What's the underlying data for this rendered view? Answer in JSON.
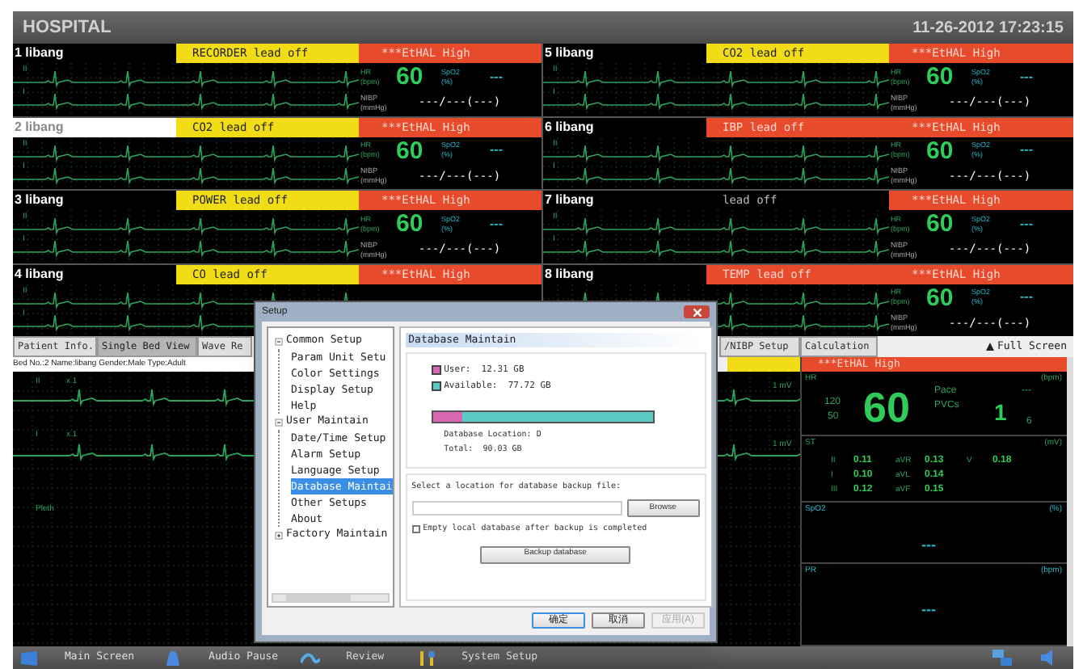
{
  "header": {
    "title": "HOSPITAL",
    "datetime": "11-26-2012 17:23:15"
  },
  "beds": [
    {
      "name": "1 libang",
      "selected": false,
      "alert": {
        "text": "RECORDER lead off",
        "color": "#f2dc16"
      },
      "alarm": "***EtHAL High",
      "leads": [
        "II",
        "I"
      ],
      "params": [
        {
          "kind": "hr",
          "label": "HR",
          "unit": "(bpm)",
          "value": "60"
        },
        {
          "kind": "spo2",
          "label": "SpO2",
          "unit": "(%)",
          "value": "---"
        },
        {
          "kind": "nibp",
          "label": "NIBP",
          "unit": "(mmHg)",
          "value": "---/---(---)"
        }
      ]
    },
    {
      "name": "5 libang",
      "selected": false,
      "alert": {
        "text": "CO2 lead off",
        "color": "#f2dc16"
      },
      "alarm": "***EtHAL High",
      "leads": [
        "II",
        "I"
      ],
      "params": [
        {
          "kind": "hr",
          "label": "HR",
          "unit": "(bpm)",
          "value": "60"
        },
        {
          "kind": "spo2",
          "label": "SpO2",
          "unit": "(%)",
          "value": "---"
        },
        {
          "kind": "nibp",
          "label": "NIBP",
          "unit": "(mmHg)",
          "value": "---/---(---)"
        }
      ]
    },
    {
      "name": "2 libang",
      "selected": true,
      "alert": {
        "text": "CO2 lead off",
        "color": "#f2dc16"
      },
      "alarm": "***EtHAL High",
      "leads": [
        "II",
        "I"
      ],
      "params": [
        {
          "kind": "hr",
          "label": "HR",
          "unit": "(bpm)",
          "value": "60"
        },
        {
          "kind": "spo2",
          "label": "SpO2",
          "unit": "(%)",
          "value": "---"
        },
        {
          "kind": "nibp",
          "label": "NIBP",
          "unit": "(mmHg)",
          "value": "---/---(---)"
        }
      ]
    },
    {
      "name": "6 libang",
      "selected": false,
      "alert": {
        "text": "IBP lead off",
        "color": "#e84a2c"
      },
      "alarm": "***EtHAL High",
      "leads": [
        "II",
        "I"
      ],
      "params": [
        {
          "kind": "hr",
          "label": "HR",
          "unit": "(bpm)",
          "value": "60"
        },
        {
          "kind": "spo2",
          "label": "SpO2",
          "unit": "(%)",
          "value": "---"
        },
        {
          "kind": "nibp",
          "label": "NIBP",
          "unit": "(mmHg)",
          "value": "---/---(---)"
        }
      ]
    },
    {
      "name": "3 libang",
      "selected": false,
      "alert": {
        "text": "POWER lead off",
        "color": "#f2dc16"
      },
      "alarm": "***EtHAL High",
      "leads": [
        "II",
        "I"
      ],
      "params": [
        {
          "kind": "hr",
          "label": "HR",
          "unit": "(bpm)",
          "value": "60"
        },
        {
          "kind": "spo2",
          "label": "SpO2",
          "unit": "(%)",
          "value": "---"
        },
        {
          "kind": "nibp",
          "label": "NIBP",
          "unit": "(mmHg)",
          "value": "---/---(---)"
        }
      ]
    },
    {
      "name": "7 libang",
      "selected": false,
      "alert": {
        "text": "lead off",
        "color": "#000000"
      },
      "alarm": "***EtHAL High",
      "leads": [
        "II",
        "I"
      ],
      "params": [
        {
          "kind": "hr",
          "label": "HR",
          "unit": "(bpm)",
          "value": "60"
        },
        {
          "kind": "spo2",
          "label": "SpO2",
          "unit": "(%)",
          "value": "---"
        },
        {
          "kind": "nibp",
          "label": "NIBP",
          "unit": "(mmHg)",
          "value": "---/---(---)"
        }
      ]
    },
    {
      "name": "4 libang",
      "selected": false,
      "alert": {
        "text": "CO lead off",
        "color": "#f2dc16"
      },
      "alarm": "***EtHAL High",
      "leads": [
        "II",
        "I"
      ]
    },
    {
      "name": "8 libang",
      "selected": false,
      "alert": {
        "text": "TEMP lead off",
        "color": "#e84a2c"
      },
      "alarm": "***EtHAL High",
      "params": [
        {
          "kind": "hr",
          "label": "HR",
          "unit": "(bpm)",
          "value": "60"
        },
        {
          "kind": "spo2",
          "label": "SpO2",
          "unit": "(%)",
          "value": "---"
        },
        {
          "kind": "nibp",
          "label": "NIBP",
          "unit": "(mmHg)",
          "value": "---/---(---)"
        }
      ]
    }
  ],
  "tabs": [
    {
      "label": "Patient Info.",
      "selected": false
    },
    {
      "label": "Single Bed View",
      "selected": true
    },
    {
      "label": "Wave Re",
      "selected": false
    },
    {
      "label": "/NIBP Setup",
      "selected": false
    },
    {
      "label": "Calculation",
      "selected": false
    }
  ],
  "full_screen": "Full Screen",
  "patient_info": "Bed No.:2 Name:libang Gender:Male Type:Adult",
  "waves": [
    {
      "label": "II",
      "gain": "x 1",
      "scale": "1 mV"
    },
    {
      "label": "I",
      "gain": "x 1",
      "scale": "1 mV"
    },
    {
      "label": "Pleth"
    }
  ],
  "detail": {
    "alarm": "***EtHAL High",
    "hr": {
      "label": "HR",
      "unit": "(bpm)",
      "high": "120",
      "low": "50",
      "value": "60",
      "pace_label": "Pace",
      "pace": "---",
      "pvcs_label": "PVCs",
      "pvcs": "1",
      "pvcs_sub": "6"
    },
    "st": {
      "label": "ST",
      "unit": "(mV)",
      "rows": [
        [
          "II",
          "0.11",
          "aVR",
          "0.13",
          "V",
          "0.18"
        ],
        [
          "I",
          "0.10",
          "aVL",
          "0.14"
        ],
        [
          "III",
          "0.12",
          "aVF",
          "0.15"
        ]
      ]
    },
    "spo2": {
      "label": "SpO2",
      "unit": "(%)",
      "value": "---"
    },
    "pr": {
      "label": "PR",
      "unit": "(bpm)",
      "value": "---"
    }
  },
  "dialog": {
    "title": "Setup",
    "tree": [
      {
        "label": "Common Setup",
        "expanded": true,
        "selected": false,
        "children": [
          {
            "label": "Param Unit Setu",
            "selected": false
          },
          {
            "label": "Color Settings",
            "selected": false
          },
          {
            "label": "Display Setup",
            "selected": false
          },
          {
            "label": "Help",
            "selected": false
          }
        ]
      },
      {
        "label": "User Maintain",
        "expanded": true,
        "selected": false,
        "children": [
          {
            "label": "Date/Time Setup",
            "selected": false
          },
          {
            "label": "Alarm Setup",
            "selected": false
          },
          {
            "label": "Language Setup",
            "selected": false
          },
          {
            "label": "Database Maintai",
            "selected": true
          },
          {
            "label": "Other Setups",
            "selected": false
          },
          {
            "label": "About",
            "selected": false
          }
        ]
      },
      {
        "label": "Factory Maintain",
        "expanded": false,
        "selected": false
      }
    ],
    "panel_title": "Database Maintain",
    "legend": [
      {
        "text": "User:  12.31 GB",
        "color": "#d966b0"
      },
      {
        "text": "Available:  77.72 GB",
        "color": "#5ccbc4"
      }
    ],
    "usage": {
      "level": 0.137
    },
    "location": "Database Location: D",
    "total": "Total:  90.03 GB",
    "select_label": "Select a location for database backup file:",
    "browse": "Browse",
    "empty_option": {
      "label": "Empty local database after backup is completed",
      "checked": false
    },
    "backup": "Backup database",
    "buttons": [
      {
        "label": "确定",
        "disabled": false,
        "default": true
      },
      {
        "label": "取消",
        "disabled": false,
        "default": false
      },
      {
        "label": "应用(A)",
        "disabled": true,
        "default": false
      }
    ]
  },
  "taskbar": [
    {
      "kind": "main",
      "label": "Main Screen"
    },
    {
      "kind": "audio",
      "label": "Audio Pause"
    },
    {
      "kind": "review",
      "label": "Review"
    },
    {
      "kind": "setup",
      "label": "System Setup"
    }
  ]
}
